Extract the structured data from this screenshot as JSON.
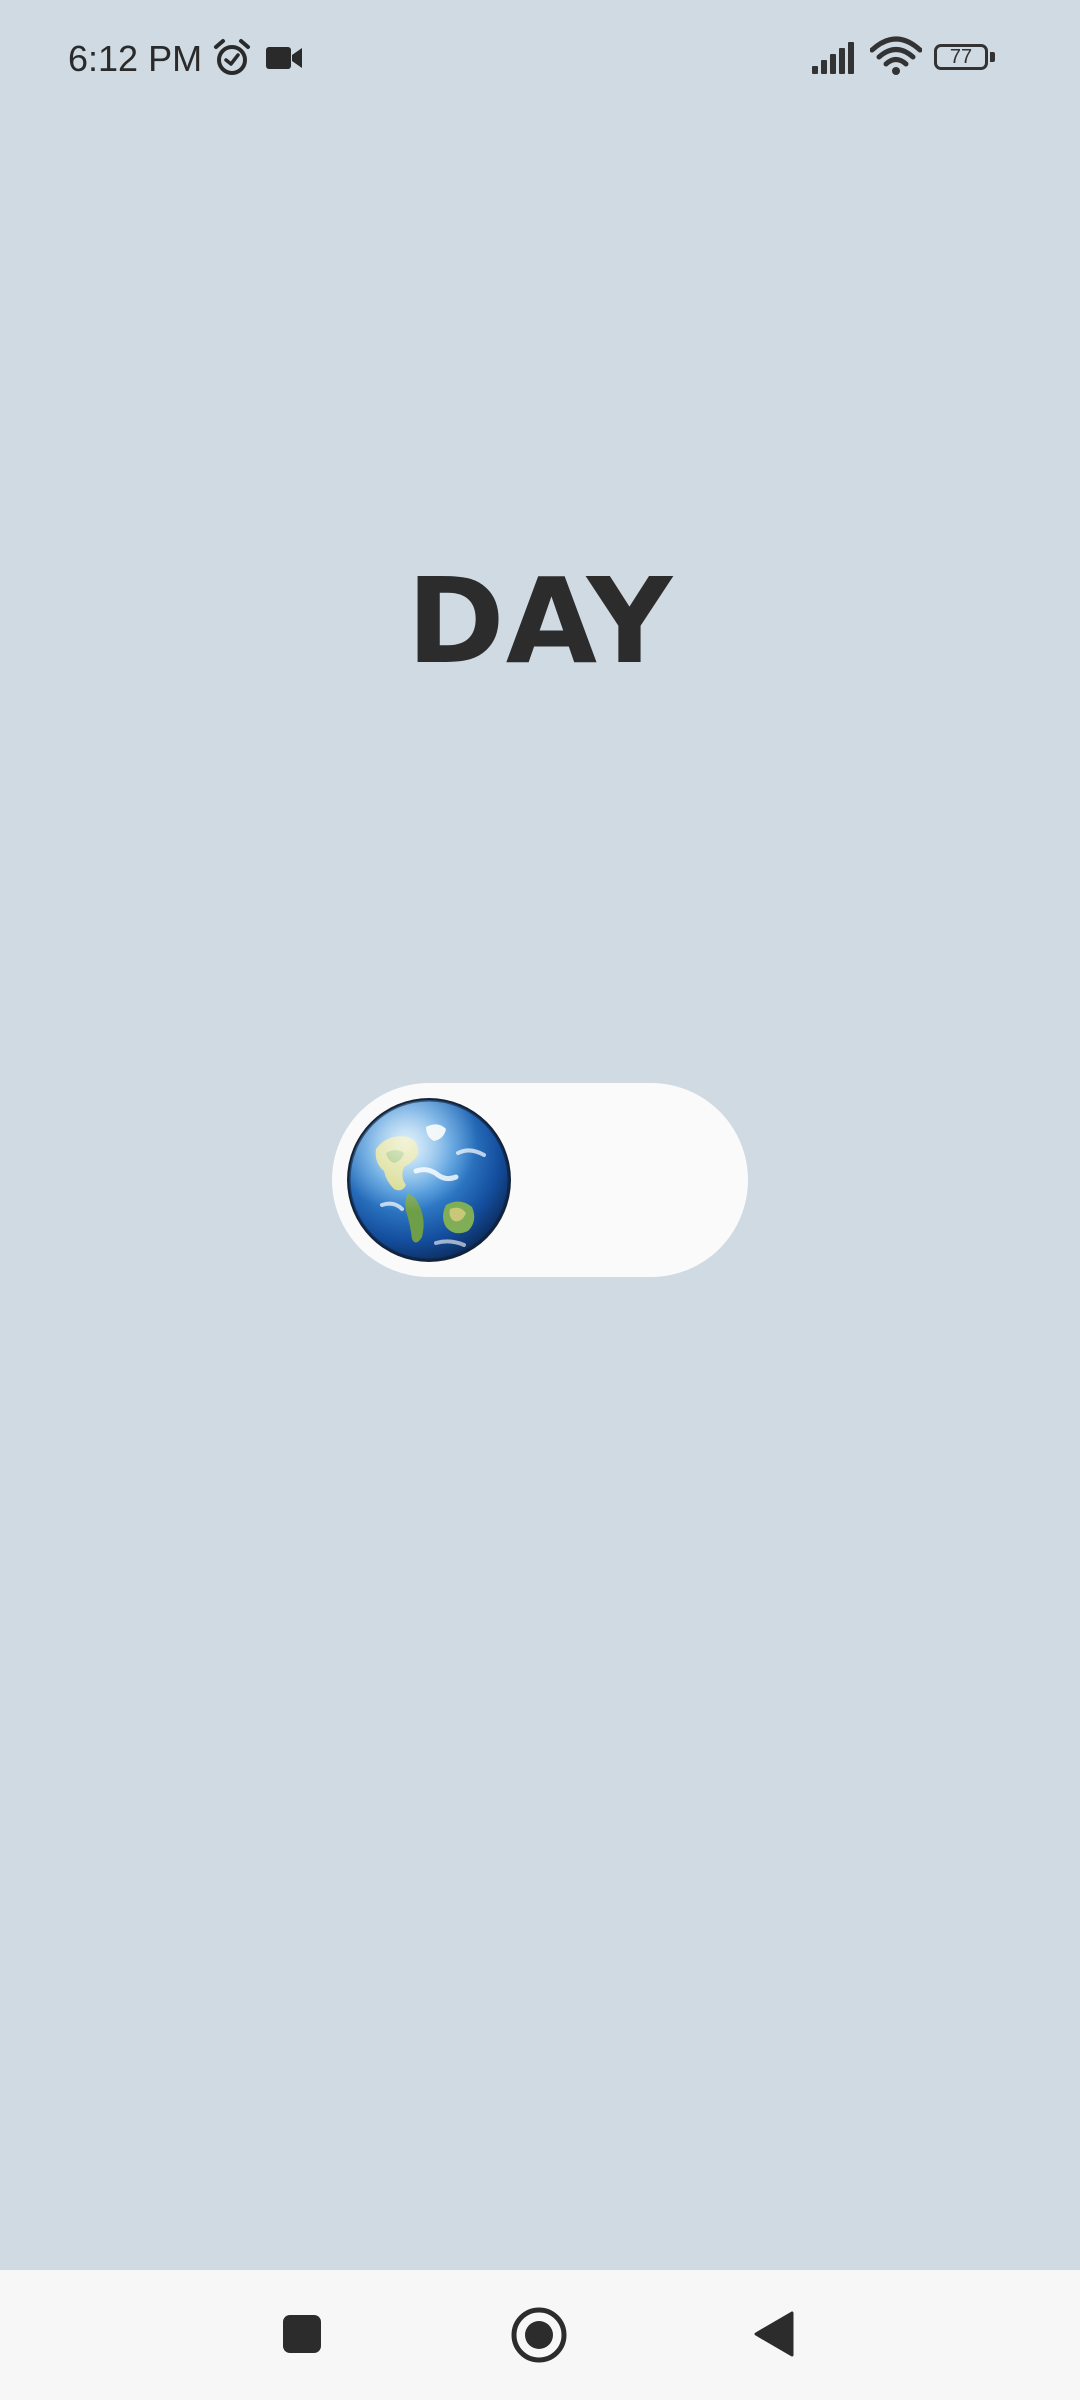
{
  "status_bar": {
    "time": "6:12 PM",
    "battery_level": "77",
    "icons": [
      "alarm-icon",
      "video-camera-icon",
      "signal-icon",
      "wifi-icon",
      "battery-icon"
    ]
  },
  "main": {
    "mode_label": "DAY",
    "toggle": {
      "state": "day",
      "knob_icon": "earth-globe-icon"
    }
  },
  "nav_bar": {
    "buttons": [
      "recents-icon",
      "home-icon",
      "back-icon"
    ]
  },
  "colors": {
    "background": "#CFDAE3",
    "toggle_track": "#FAFAFA",
    "text": "#2C2C2C",
    "nav_background": "#F7F7F7"
  }
}
